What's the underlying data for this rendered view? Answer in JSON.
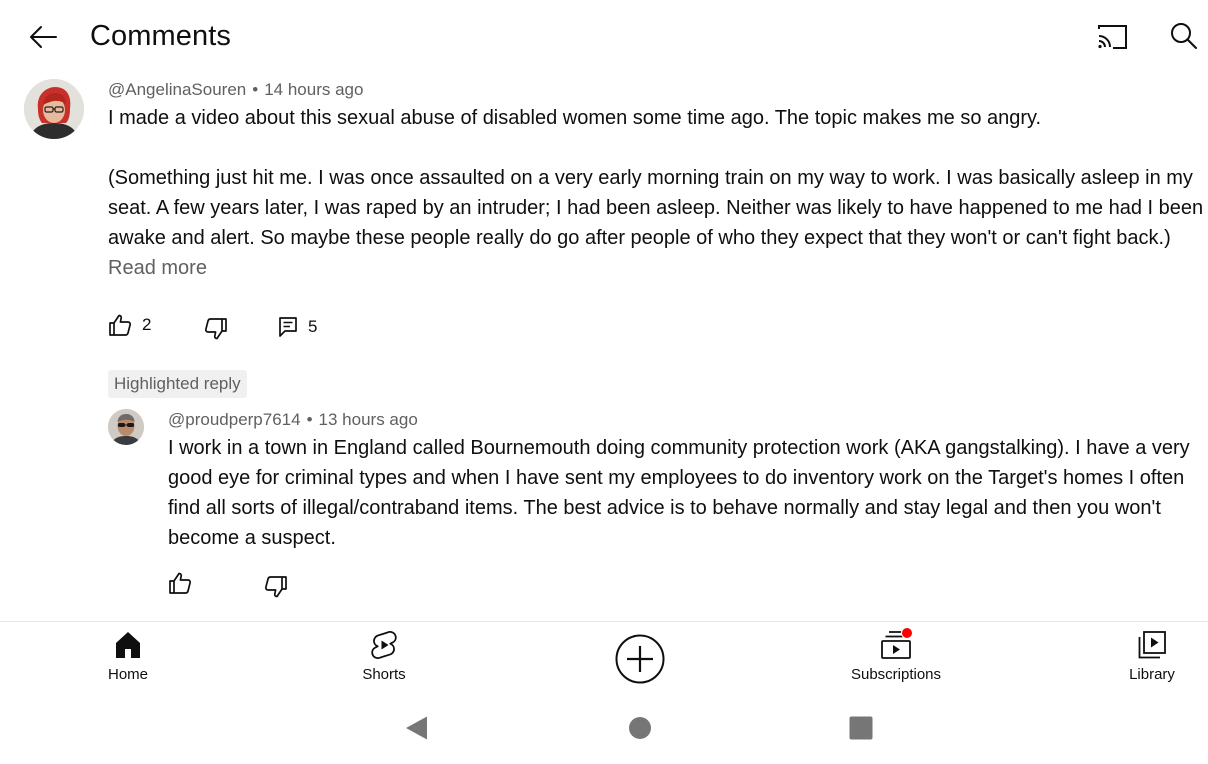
{
  "header": {
    "title": "Comments",
    "back_icon": "arrow-left-icon",
    "cast_icon": "cast-icon",
    "search_icon": "search-icon"
  },
  "comment": {
    "author": "@AngelinaSouren",
    "separator": "•",
    "time": "14 hours ago",
    "paragraph1": "I made a video about this sexual abuse of disabled women some time ago. The topic makes me so angry.",
    "paragraph2_lines": [
      "(Something just hit me. I was once assaulted on a very early morning train on my way to work. I was basically asleep in my",
      "seat. A few years later, I was raped by an intruder; I had been asleep. Neither was likely to have happened to me had I been",
      "awake and alert. So maybe these people really do go after people of who they expect that they won't or can't fight back.)"
    ],
    "read_more": "Read more",
    "like_count": "2",
    "reply_count": "5"
  },
  "highlighted_label": "Highlighted reply",
  "reply": {
    "author": "@proudperp7614",
    "separator": "•",
    "time": "13 hours ago",
    "lines": [
      "I work in a town in England called Bournemouth doing community protection work (AKA gangstalking). I have a very",
      "good eye for criminal types and when I have sent my employees to do inventory work on the Target's homes I often",
      "find all sorts of illegal/contraband items. The best advice is to behave normally and stay legal and then you won't",
      "become a suspect."
    ]
  },
  "bottom_nav": {
    "home": "Home",
    "shorts": "Shorts",
    "subscriptions": "Subscriptions",
    "library": "Library"
  },
  "colors": {
    "text_primary": "#0f0f0f",
    "text_secondary": "#606060",
    "notification": "#ff0000",
    "chip_bg": "#f0f0f0"
  }
}
